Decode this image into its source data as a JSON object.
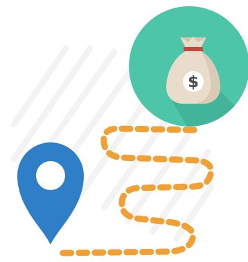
{
  "icons": {
    "money_bag": "money-bag-icon",
    "location_pin": "location-pin-icon",
    "route": "dashed-route-path"
  },
  "money_bag": {
    "symbol": "$"
  },
  "colors": {
    "badge_teal": "#4dc5a9",
    "badge_shadow": "#3aa58c",
    "bag_body": "#e9dccb",
    "bag_shade": "#d3c2ad",
    "bag_tie": "#c8463a",
    "dollar_text": "#4a4a4a",
    "pin_blue": "#2f7fc8",
    "route_orange": "#f0a035",
    "background_stripes": "#f3f3f3"
  }
}
